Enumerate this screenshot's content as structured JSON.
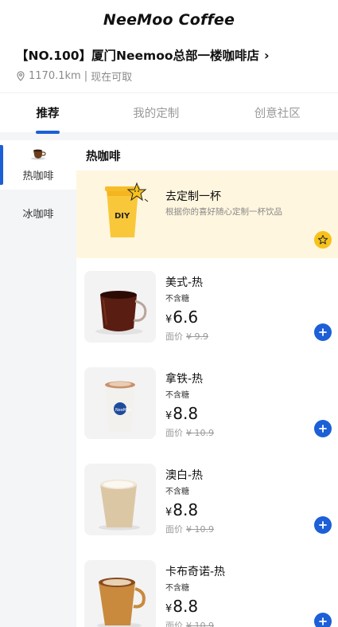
{
  "header": {
    "brand": "NeeMoo Coffee"
  },
  "store": {
    "name": "【NO.100】厦门Neemoo总部一楼咖啡店",
    "distance": "1170.1km",
    "separator": "|",
    "status": "现在可取"
  },
  "tabs": [
    {
      "label": "推荐",
      "active": true
    },
    {
      "label": "我的定制",
      "active": false
    },
    {
      "label": "创意社区",
      "active": false
    }
  ],
  "sidebar": {
    "items": [
      {
        "label": "热咖啡",
        "icon": "coffee-cup-icon",
        "active": true
      },
      {
        "label": "冰咖啡",
        "active": false
      }
    ]
  },
  "main": {
    "section_title": "热咖啡",
    "diy": {
      "cup_label": "DIY",
      "title": "去定制一杯",
      "subtitle": "根据你的喜好随心定制一杯饮品"
    },
    "products": [
      {
        "name": "美式-热",
        "sugar": "不含糖",
        "currency": "¥",
        "price": "6.6",
        "orig_label": "面价",
        "orig_price": "¥ 9.9"
      },
      {
        "name": "拿铁-热",
        "sugar": "不含糖",
        "currency": "¥",
        "price": "8.8",
        "orig_label": "面价",
        "orig_price": "¥ 10.9"
      },
      {
        "name": "澳白-热",
        "sugar": "不含糖",
        "currency": "¥",
        "price": "8.8",
        "orig_label": "面价",
        "orig_price": "¥ 10.9"
      },
      {
        "name": "卡布奇诺-热",
        "sugar": "不含糖",
        "currency": "¥",
        "price": "8.8",
        "orig_label": "面价",
        "orig_price": "¥ 10.9"
      }
    ]
  },
  "colors": {
    "accent": "#1c5fd6",
    "diy_bg": "#fff6df",
    "star": "#f7c21a",
    "sidebar_bg": "#f4f5f7"
  }
}
